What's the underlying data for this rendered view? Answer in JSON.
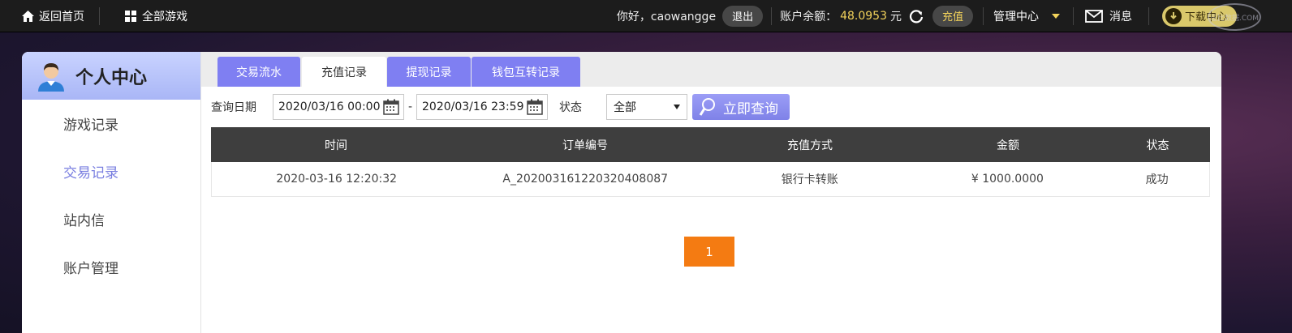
{
  "topbar": {
    "home_label": "返回首页",
    "all_games_label": "全部游戏",
    "greeting": "你好，caowangge",
    "logout_label": "退出",
    "balance_label": "账户余额：",
    "balance_value": "48.0953",
    "balance_unit": "元",
    "recharge_label": "充值",
    "admin_label": "管理中心",
    "messages_label": "消息",
    "download_label": "下载中心",
    "watermark_text": "逗比数据.COM",
    "accent_color": "#f3d35b"
  },
  "sidebar": {
    "title": "个人中心",
    "items": [
      {
        "label": "游戏记录"
      },
      {
        "label": "交易记录",
        "active": true
      },
      {
        "label": "站内信"
      },
      {
        "label": "账户管理"
      }
    ]
  },
  "tabs": [
    {
      "label": "交易流水"
    },
    {
      "label": "充值记录",
      "active": true
    },
    {
      "label": "提现记录"
    },
    {
      "label": "钱包互转记录"
    }
  ],
  "filter": {
    "date_label": "查询日期",
    "start_date": "2020/03/16 00:00",
    "separator": "-",
    "end_date": "2020/03/16 23:59",
    "status_label": "状态",
    "status_value": "全部",
    "query_label": "立即查询"
  },
  "table": {
    "headers": [
      "时间",
      "订单编号",
      "充值方式",
      "金额",
      "状态"
    ],
    "rows": [
      [
        "2020-03-16 12:20:32",
        "A_202003161220320408087",
        "银行卡转账",
        "¥ 1000.0000",
        "成功"
      ]
    ]
  },
  "pagination": {
    "current": "1"
  },
  "colors": {
    "tab": "#7f7ff2",
    "pager": "#f47b12",
    "header": "#3e3e3e"
  }
}
